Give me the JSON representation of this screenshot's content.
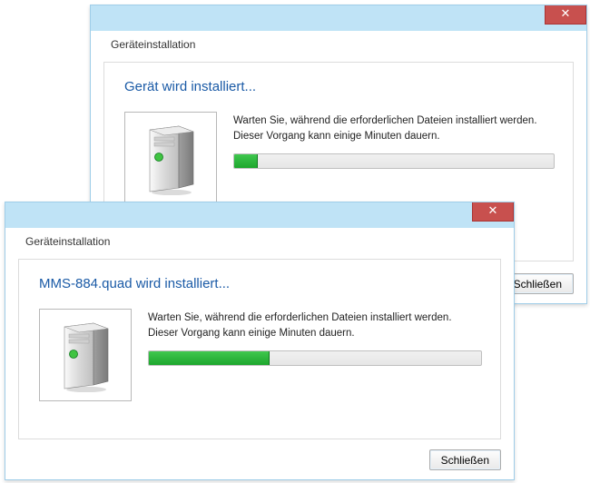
{
  "dialog_back": {
    "title": "Geräteinstallation",
    "heading": "Gerät wird installiert...",
    "body": "Warten Sie, während die erforderlichen Dateien installiert werden. Dieser Vorgang kann einige Minuten dauern.",
    "close_label": "Schließen",
    "progress_percent": 7
  },
  "dialog_front": {
    "title": "Geräteinstallation",
    "heading": "MMS-884.quad wird installiert...",
    "body": "Warten Sie, während die erforderlichen Dateien installiert werden. Dieser Vorgang kann einige Minuten dauern.",
    "close_label": "Schließen",
    "progress_percent": 36
  },
  "close_glyph": "✕",
  "colors": {
    "titlebar": "#bfe3f6",
    "border": "#9fcde8",
    "heading": "#1a5aa6",
    "close_bg": "#c8504e",
    "progress_fill": "#1da62d"
  }
}
